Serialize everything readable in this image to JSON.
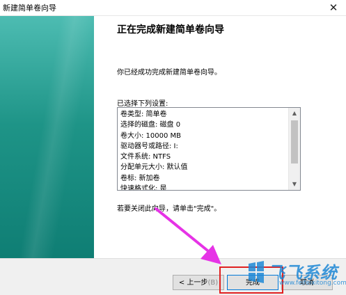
{
  "window": {
    "title": "新建简单卷向导",
    "close_glyph": "✕"
  },
  "wizard": {
    "heading": "正在完成新建简单卷向导",
    "description": "你已经成功完成新建简单卷向导。",
    "settings_label": "已选择下列设置:",
    "settings": [
      "卷类型: 简单卷",
      "选择的磁盘: 磁盘 0",
      "卷大小: 10000 MB",
      "驱动器号或路径: I:",
      "文件系统: NTFS",
      "分配单元大小: 默认值",
      "卷标: 新加卷",
      "快速格式化: 是"
    ],
    "close_hint": "若要关闭此向导，请单击\"完成\"。"
  },
  "buttons": {
    "back_label": "< 上一步",
    "back_mnemonic": "(B)",
    "finish_label": "完成",
    "cancel_label": "取消"
  },
  "watermark": {
    "title": "飞飞系统",
    "url": "www.feifeixitong.com"
  },
  "colors": {
    "sidebar": "#1e9487",
    "accent": "#0078d7",
    "annotation_arrow": "#e633e6",
    "highlight_box": "#e02020"
  }
}
